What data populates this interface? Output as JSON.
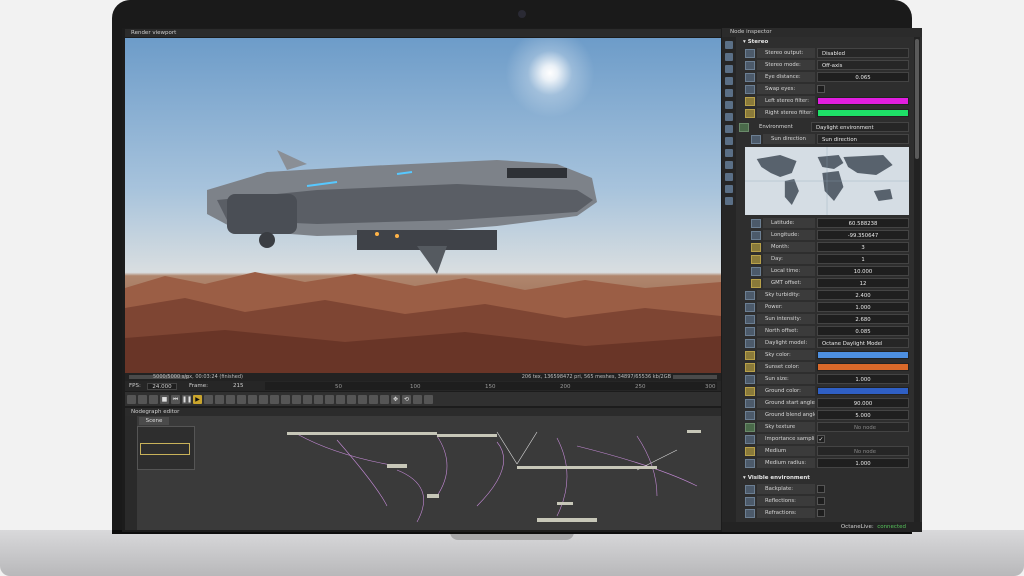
{
  "panels": {
    "viewport_title": "Render viewport",
    "inspector_title": "Node inspector",
    "nodegraph_title": "Nodegraph editor",
    "nodegraph_tab": "Scene"
  },
  "viewport": {
    "status_left": "5000/5000 s/px, 00:03:24 (finished)",
    "status_right": "206 tex, 136598472 pri, 565 meshes, 34897/65536 kb/2GB"
  },
  "timeline": {
    "fps_label": "FPS:",
    "fps_value": "24.000",
    "frame_label": "Frame:",
    "frame_value": "215",
    "ticks": [
      "50",
      "100",
      "150",
      "200",
      "250",
      "300"
    ]
  },
  "inspector": {
    "stereo": {
      "header": "Stereo",
      "stereo_output_label": "Stereo output:",
      "stereo_output_value": "Disabled",
      "stereo_mode_label": "Stereo mode:",
      "stereo_mode_value": "Off-axis",
      "eye_distance_label": "Eye distance:",
      "eye_distance_value": "0.065",
      "swap_eyes_label": "Swap eyes:",
      "left_filter_label": "Left stereo filter:",
      "left_filter_color": "#e21ee0",
      "right_filter_label": "Right stereo filter:",
      "right_filter_color": "#1ee067"
    },
    "environment": {
      "header": "Environment",
      "type_value": "Daylight environment",
      "sun_direction_label": "Sun direction",
      "sun_direction_value": "Sun direction",
      "latitude_label": "Latitude:",
      "latitude_value": "60.588238",
      "longitude_label": "Longitude:",
      "longitude_value": "-99.350647",
      "month_label": "Month:",
      "month_value": "3",
      "day_label": "Day:",
      "day_value": "1",
      "local_time_label": "Local time:",
      "local_time_value": "10.000",
      "gmt_offset_label": "GMT offset:",
      "gmt_offset_value": "12",
      "sky_turbidity_label": "Sky turbidity:",
      "sky_turbidity_value": "2.400",
      "power_label": "Power:",
      "power_value": "1.000",
      "sun_intensity_label": "Sun intensity:",
      "sun_intensity_value": "2.680",
      "north_offset_label": "North offset:",
      "north_offset_value": "0.085",
      "daylight_model_label": "Daylight model:",
      "daylight_model_value": "Octane Daylight Model",
      "sky_color_label": "Sky color:",
      "sky_color": "#4d8fe0",
      "sunset_color_label": "Sunset color:",
      "sunset_color": "#d9692a",
      "sun_size_label": "Sun size:",
      "sun_size_value": "1.000",
      "ground_color_label": "Ground color:",
      "ground_color": "#2f5fc4",
      "ground_start_label": "Ground start angle:",
      "ground_start_value": "90.000",
      "ground_blend_label": "Ground blend angle:",
      "ground_blend_value": "5.000",
      "sky_texture_label": "Sky texture",
      "sky_texture_value": "No node",
      "importance_label": "Importance sampling:",
      "medium_label": "Medium",
      "medium_value": "No node",
      "medium_radius_label": "Medium radius:",
      "medium_radius_value": "1.000"
    },
    "visible_env": {
      "header": "Visible environment",
      "backplate_label": "Backplate:",
      "reflections_label": "Reflections:",
      "refractions_label": "Refractions:"
    },
    "footer_label": "OctaneLive:",
    "footer_status": "connected"
  }
}
